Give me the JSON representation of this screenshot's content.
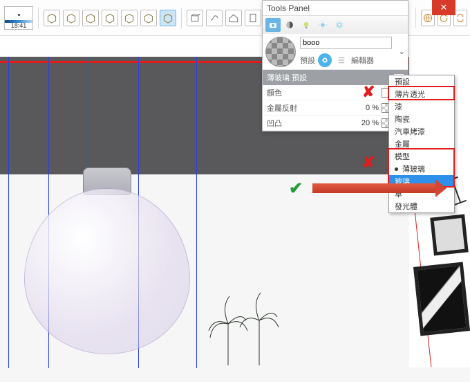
{
  "panel": {
    "title": "Tools Panel"
  },
  "clock": {
    "time": "18:41"
  },
  "material": {
    "name": "booo",
    "preset_label": "預設",
    "editor_label": "編輯器"
  },
  "section_header": "薄玻璃 預設",
  "props": {
    "color": {
      "label": "顏色",
      "value": ""
    },
    "metal": {
      "label": "金屬反射",
      "value": "0 %"
    },
    "bump": {
      "label": "凹凸",
      "value": "20 %"
    }
  },
  "menu": {
    "items": [
      "預設",
      "薄片透光",
      "漆",
      "陶瓷",
      "汽車烤漆",
      "金屬",
      "模型",
      "薄玻璃",
      "玻璃",
      "草",
      "發光體"
    ],
    "selected_index": 8
  },
  "toolbar_icons": [
    "cube-a",
    "cube-b",
    "cube-c",
    "cube-d",
    "cube-e",
    "cube-f",
    "cube-g",
    "box",
    "stack",
    "house",
    "doc",
    "home-outline",
    "tray"
  ],
  "right_icons": [
    "globe",
    "undo",
    "loop"
  ],
  "panel_tabs": [
    "camera",
    "checker",
    "bulb",
    "sun",
    "gear"
  ]
}
